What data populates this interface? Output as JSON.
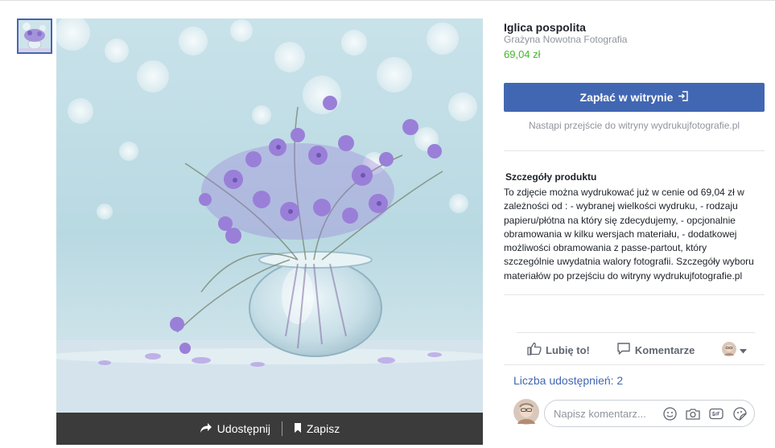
{
  "product": {
    "title": "Iglica pospolita",
    "seller": "Grażyna Nowotna Fotografia",
    "price": "69,04 zł"
  },
  "checkout": {
    "button_label": "Zapłać w witrynie",
    "note": "Nastąpi przejście do witryny wydrukujfotografie.pl"
  },
  "details": {
    "heading": "Szczegóły produktu",
    "text": "To zdjęcie można wydrukować już w cenie od 69,04 zł w zależności od : - wybranej wielkości wydruku, - rodzaju papieru/płótna na który się zdecydujemy, - opcjonalnie obramowania w kilku wersjach materiału, - dodatkowej możliwości obramowania z passe-partout, który szczególnie uwydatnia walory fotografii. Szczegóły wyboru materiałów po przejściu do witryny wydrukujfotografie.pl"
  },
  "photo_bar": {
    "share_label": "Udostępnij",
    "save_label": "Zapisz"
  },
  "social": {
    "like_label": "Lubię to!",
    "comment_label": "Komentarze",
    "shares_count_label": "Liczba udostępnień: 2"
  },
  "composer": {
    "placeholder": "Napisz komentarz..."
  },
  "icons": {
    "pay": "external-login-icon",
    "share": "share-arrow-icon",
    "save": "bookmark-icon",
    "like": "thumbs-up-icon",
    "comment": "speech-bubble-icon",
    "emoji": "emoji-icon",
    "camera": "camera-icon",
    "gif": "gif-icon",
    "sticker": "sticker-icon"
  },
  "colors": {
    "accent": "#4267b2",
    "price": "#42b72a",
    "bar": "#3b3b3b"
  }
}
